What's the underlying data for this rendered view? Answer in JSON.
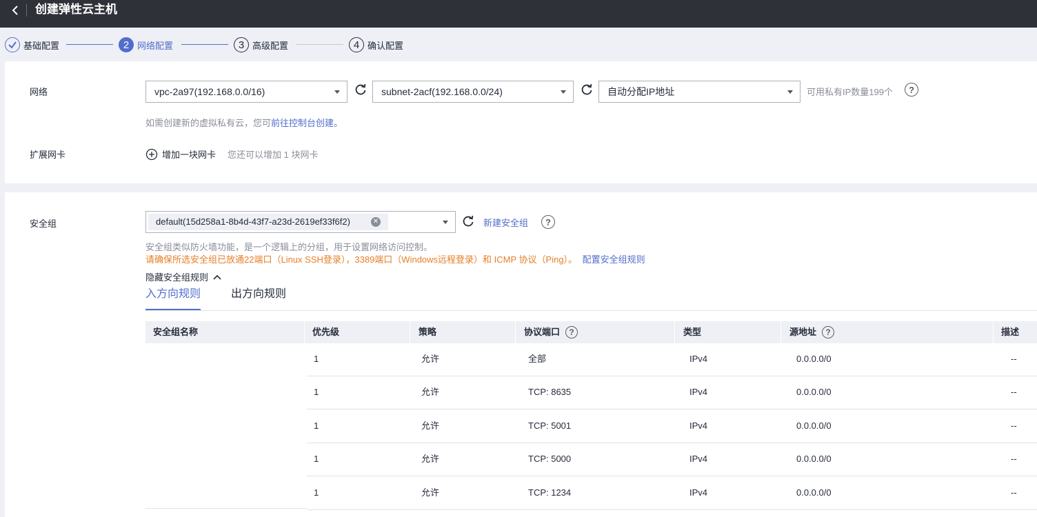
{
  "header": {
    "title": "创建弹性云主机"
  },
  "steps": [
    {
      "label": "基础配置",
      "num": "✓"
    },
    {
      "label": "网络配置",
      "num": "2"
    },
    {
      "label": "高级配置",
      "num": "3"
    },
    {
      "label": "确认配置",
      "num": "4"
    }
  ],
  "network": {
    "label": "网络",
    "vpc": "vpc-2a97(192.168.0.0/16)",
    "subnet": "subnet-2acf(192.168.0.0/24)",
    "ip_mode": "自动分配IP地址",
    "ip_available": "可用私有IP数量199个",
    "hint_prefix": "如需创建新的虚拟私有云，您可",
    "hint_link": "前往控制台创建",
    "hint_suffix": "。"
  },
  "nic": {
    "label": "扩展网卡",
    "add_label": "增加一块网卡",
    "hint": "您还可以增加 1 块网卡"
  },
  "security": {
    "label": "安全组",
    "selected": "default(15d258a1-8b4d-43f7-a23d-2619ef33f6f2)",
    "create_link": "新建安全组",
    "desc": "安全组类似防火墙功能，是一个逻辑上的分组，用于设置网络访问控制。",
    "warning": "请确保所选安全组已放通22端口（Linux SSH登录），3389端口（Windows远程登录）和 ICMP 协议（Ping）。",
    "config_link": "配置安全组规则",
    "toggle": "隐藏安全组规则"
  },
  "rules": {
    "tabs": [
      "入方向规则",
      "出方向规则"
    ],
    "columns": [
      "安全组名称",
      "优先级",
      "策略",
      "协议端口",
      "类型",
      "源地址",
      "描述"
    ],
    "rows": [
      {
        "priority": "1",
        "policy": "允许",
        "port": "全部",
        "type": "IPv4",
        "source": "0.0.0.0/0",
        "desc": "--"
      },
      {
        "priority": "1",
        "policy": "允许",
        "port": "TCP: 8635",
        "type": "IPv4",
        "source": "0.0.0.0/0",
        "desc": "--"
      },
      {
        "priority": "1",
        "policy": "允许",
        "port": "TCP: 5001",
        "type": "IPv4",
        "source": "0.0.0.0/0",
        "desc": "--"
      },
      {
        "priority": "1",
        "policy": "允许",
        "port": "TCP: 5000",
        "type": "IPv4",
        "source": "0.0.0.0/0",
        "desc": "--"
      },
      {
        "priority": "1",
        "policy": "允许",
        "port": "TCP: 1234",
        "type": "IPv4",
        "source": "0.0.0.0/0",
        "desc": "--"
      }
    ]
  },
  "colors": {
    "accent": "#526ecc",
    "warning": "#e67f27",
    "topbar": "#2f3139"
  }
}
